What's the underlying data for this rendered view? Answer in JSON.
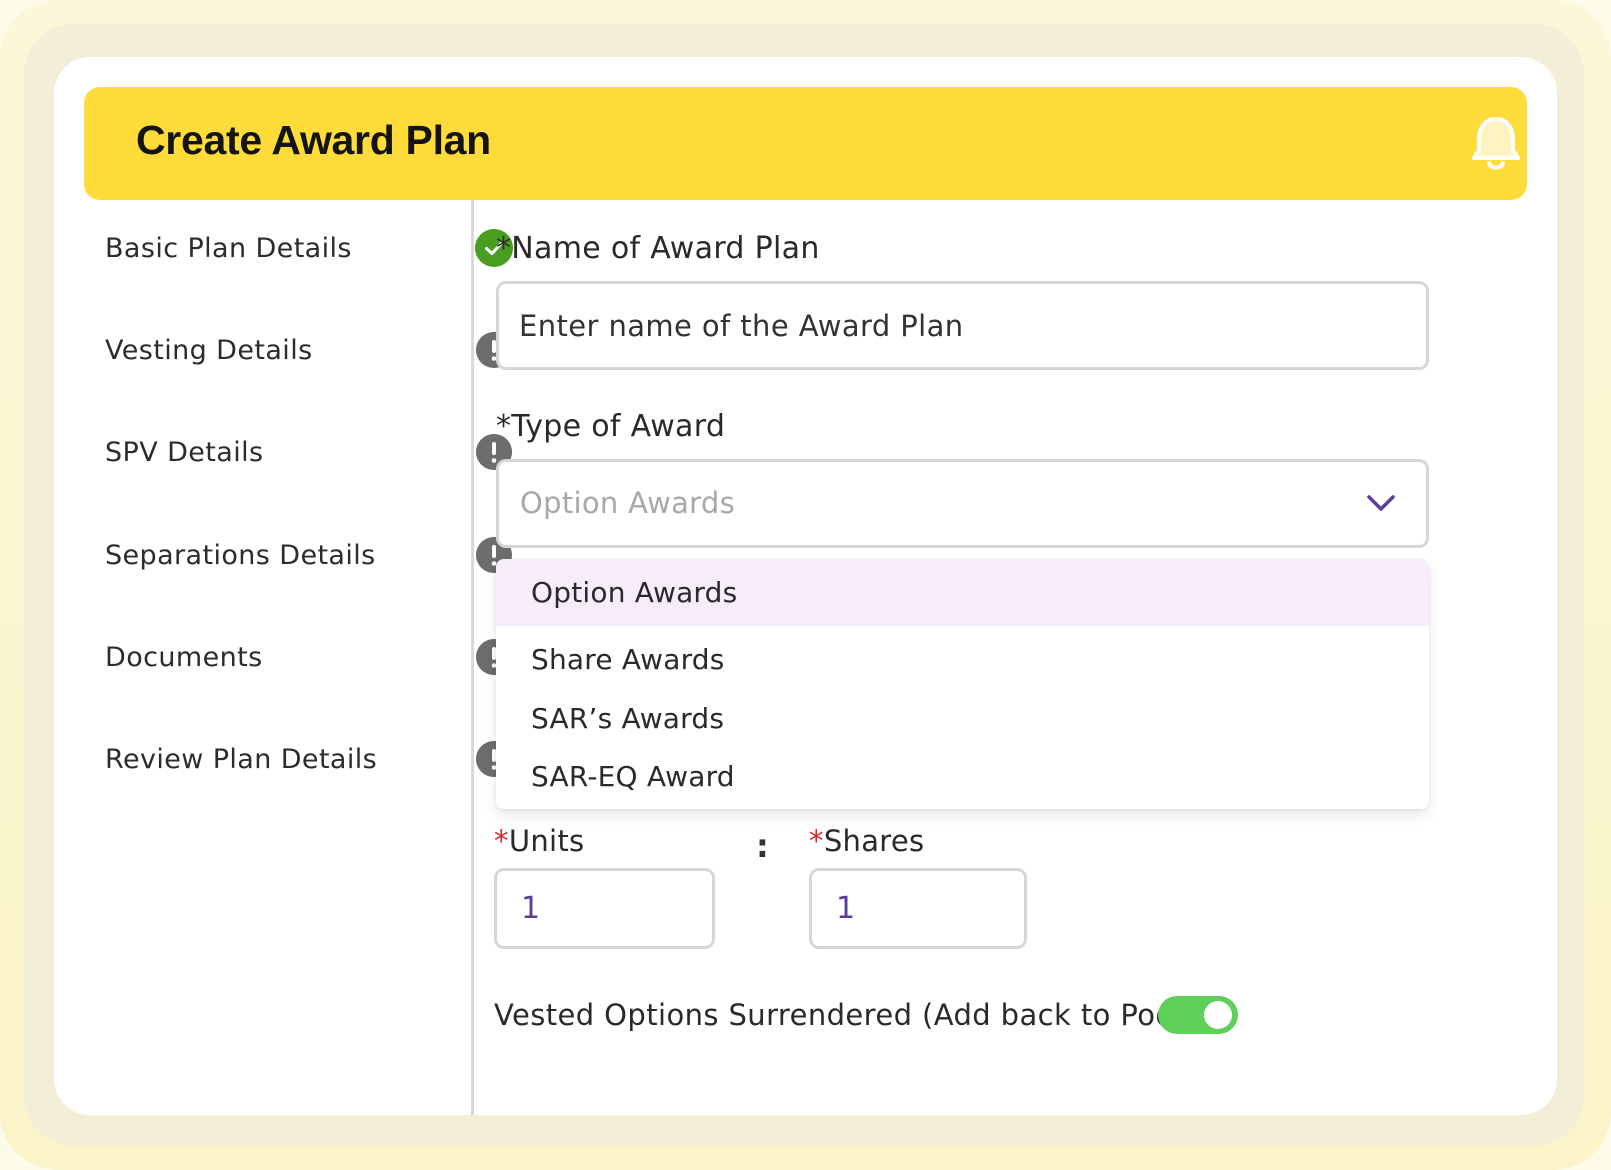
{
  "header": {
    "title": "Create Award Plan",
    "notification_icon": "bell-icon",
    "accent_color": "#ffdc3a"
  },
  "steps": [
    {
      "label": "Basic Plan Details",
      "status": "complete",
      "icon": "check-circle-icon"
    },
    {
      "label": "Vesting Details",
      "status": "incomplete",
      "icon": "exclamation-circle-icon"
    },
    {
      "label": "SPV Details",
      "status": "incomplete",
      "icon": "exclamation-circle-icon"
    },
    {
      "label": "Separations Details",
      "status": "incomplete",
      "icon": "exclamation-circle-icon"
    },
    {
      "label": "Documents",
      "status": "incomplete",
      "icon": "exclamation-circle-icon"
    },
    {
      "label": "Review Plan Details",
      "status": "incomplete",
      "icon": "exclamation-circle-icon"
    }
  ],
  "form": {
    "plan_name": {
      "label": "*Name of Award Plan",
      "value": "",
      "placeholder": "Enter name of the Award Plan"
    },
    "award_type": {
      "label": "*Type of Award",
      "selected": "Option Awards",
      "options": [
        "Option Awards",
        "Share Awards",
        "SAR’s Awards",
        "SAR-EQ Award"
      ],
      "highlighted_index": 0
    },
    "ratio": {
      "units_required_mark": "*",
      "units_label": "Units",
      "units_value": "1",
      "separator": ":",
      "shares_required_mark": "*",
      "shares_label": "Shares",
      "shares_value": "1"
    },
    "vested_surrendered": {
      "label": "Vested Options Surrendered (Add back to Pool)",
      "enabled": true,
      "on_color": "#5ed05a"
    }
  },
  "colors": {
    "complete": "#4a9e1f",
    "incomplete": "#6d6d6d",
    "required": "#d12a2a",
    "highlight_option": "#f6ecfa",
    "chevron": "#5a3f9a"
  }
}
